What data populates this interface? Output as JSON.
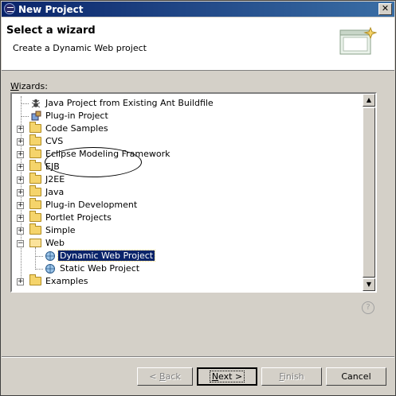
{
  "window": {
    "title": "New Project"
  },
  "header": {
    "title": "Select a wizard",
    "description": "Create a Dynamic Web project"
  },
  "wizards_label": {
    "prefix": "W",
    "rest": "izards:"
  },
  "tree": {
    "items": [
      {
        "label": "Java Project from Existing Ant Buildfile",
        "kind": "wizard",
        "icon": "ant-icon"
      },
      {
        "label": "Plug-in Project",
        "kind": "wizard",
        "icon": "plugin-icon"
      },
      {
        "label": "Code Samples",
        "kind": "folder",
        "expanded": false
      },
      {
        "label": "CVS",
        "kind": "folder",
        "expanded": false
      },
      {
        "label": "Eclipse Modeling Framework",
        "kind": "folder",
        "expanded": false
      },
      {
        "label": "EJB",
        "kind": "folder",
        "expanded": false
      },
      {
        "label": "J2EE",
        "kind": "folder",
        "expanded": false
      },
      {
        "label": "Java",
        "kind": "folder",
        "expanded": false
      },
      {
        "label": "Plug-in Development",
        "kind": "folder",
        "expanded": false
      },
      {
        "label": "Portlet Projects",
        "kind": "folder",
        "expanded": false
      },
      {
        "label": "Simple",
        "kind": "folder",
        "expanded": false
      },
      {
        "label": "Web",
        "kind": "folder",
        "expanded": true
      },
      {
        "label": "Dynamic Web Project",
        "kind": "wizard-child",
        "selected": true
      },
      {
        "label": "Static Web Project",
        "kind": "wizard-child"
      },
      {
        "label": "Examples",
        "kind": "folder",
        "expanded": false
      }
    ]
  },
  "buttons": {
    "back": {
      "label_pre": "< ",
      "label_u": "B",
      "label_post": "ack"
    },
    "next": {
      "label_u": "N",
      "label_post": "ext >"
    },
    "finish": {
      "label_u": "F",
      "label_post": "inish"
    },
    "cancel": {
      "label": "Cancel"
    }
  },
  "colors": {
    "title_bar": "#0a246a",
    "selection": "#0a246a",
    "folder": "#f5d46b",
    "dialog_bg": "#d4d0c8"
  }
}
